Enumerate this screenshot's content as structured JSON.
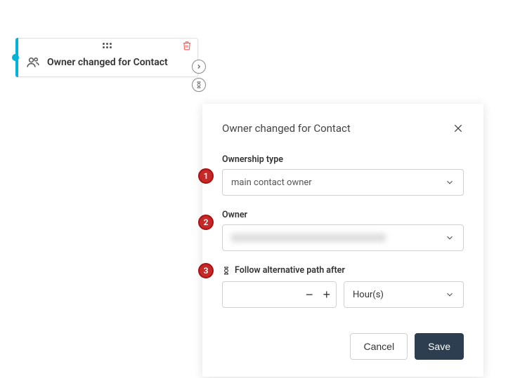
{
  "node": {
    "title": "Owner changed for Contact"
  },
  "panel": {
    "title": "Owner changed for Contact",
    "ownership_type_label": "Ownership type",
    "ownership_type_value": "main contact owner",
    "owner_label": "Owner",
    "follow_alt_label": "Follow alternative path after",
    "unit_value": "Hour(s)",
    "cancel_label": "Cancel",
    "save_label": "Save"
  },
  "callouts": {
    "c1": "1",
    "c2": "2",
    "c3": "3"
  }
}
